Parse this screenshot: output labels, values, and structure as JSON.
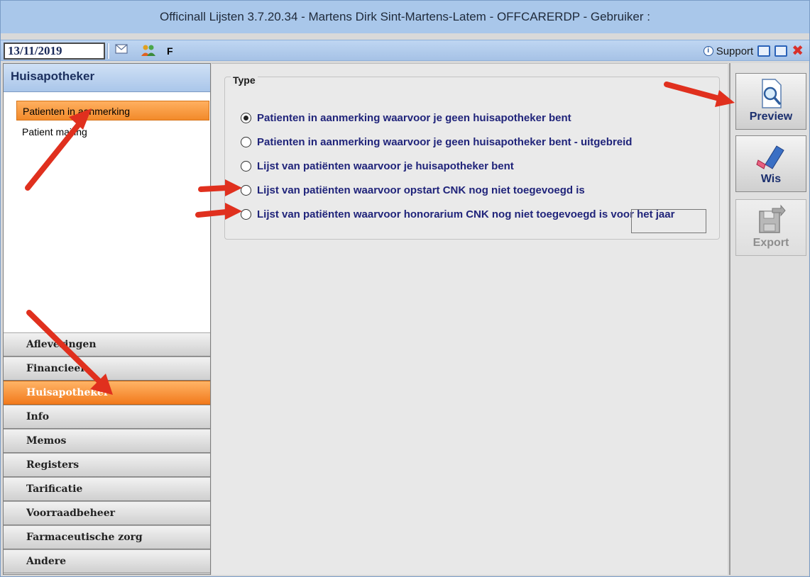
{
  "window": {
    "title": "Officinall Lijsten 3.7.20.34 - Martens Dirk Sint-Martens-Latem - OFFCARERDP - Gebruiker :"
  },
  "toolbar": {
    "date": "13/11/2019",
    "letter": "F",
    "support_label": "Support",
    "icons": [
      "envelope-icon",
      "users-icon",
      "info-icon",
      "window-restore-icon",
      "window-minimize-icon",
      "close-icon"
    ]
  },
  "sidebar": {
    "header": "Huisapotheker",
    "items": [
      {
        "label": "Patienten in aanmerking",
        "active": true
      },
      {
        "label": "Patient mailing",
        "active": false
      }
    ],
    "nav": [
      {
        "label": "Afleveringen",
        "active": false
      },
      {
        "label": "Financieel",
        "active": false
      },
      {
        "label": "Huisapotheker",
        "active": true
      },
      {
        "label": "Info",
        "active": false
      },
      {
        "label": "Memos",
        "active": false
      },
      {
        "label": "Registers",
        "active": false
      },
      {
        "label": "Tarificatie",
        "active": false
      },
      {
        "label": "Voorraadbeheer",
        "active": false
      },
      {
        "label": "Farmaceutische zorg",
        "active": false
      },
      {
        "label": "Andere",
        "active": false
      }
    ]
  },
  "type_group": {
    "title": "Type",
    "selected_index": 0,
    "options": [
      "Patienten in aanmerking waarvoor je geen huisapotheker bent",
      "Patienten in aanmerking waarvoor je geen huisapotheker bent - uitgebreid",
      "Lijst van patiënten waarvoor je huisapotheker bent",
      "Lijst van patiënten waarvoor opstart CNK nog niet toegevoegd is",
      "Lijst van patiënten waarvoor honorarium CNK nog niet toegevoegd is voor het jaar"
    ],
    "year_value": ""
  },
  "actions": {
    "preview": "Preview",
    "wis": "Wis",
    "export": "Export"
  },
  "colors": {
    "accent_orange": "#f28a2a",
    "title_blue": "#a9c7ea",
    "label_navy": "#20247a",
    "annotation_red": "#e0301e"
  }
}
